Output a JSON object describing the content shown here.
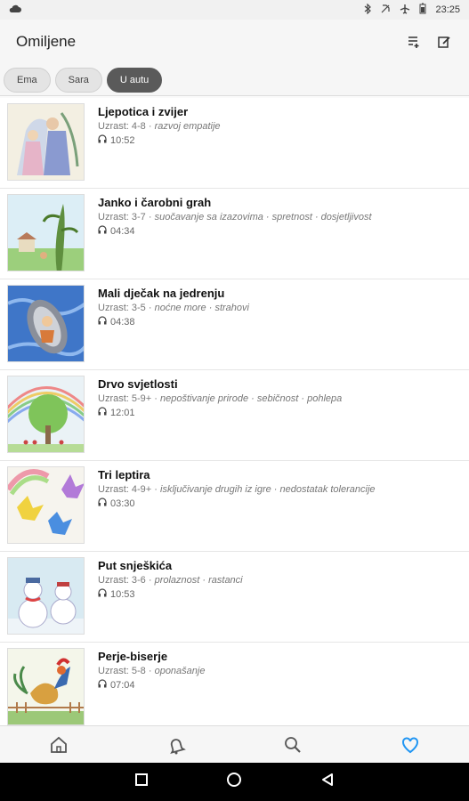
{
  "status": {
    "time": "23:25",
    "icons": [
      "cloud-icon",
      "bluetooth-icon",
      "dnd-icon",
      "airplane-icon",
      "battery-icon"
    ]
  },
  "app_bar": {
    "title": "Omiljene",
    "actions": [
      "playlist-add-icon",
      "edit-icon"
    ]
  },
  "chips": [
    {
      "label": "Ema",
      "active": false
    },
    {
      "label": "Sara",
      "active": false
    },
    {
      "label": "U autu",
      "active": true
    }
  ],
  "stories": [
    {
      "title": "Ljepotica i zvijer",
      "age": "Uzrast: 4-8",
      "topics": "razvoj empatije",
      "duration": "10:52"
    },
    {
      "title": "Janko i čarobni grah",
      "age": "Uzrast: 3-7",
      "topics": "suočavanje sa izazovima · spretnost · dosjetljivost",
      "duration": "04:34"
    },
    {
      "title": "Mali dječak na jedrenju",
      "age": "Uzrast: 3-5",
      "topics": "noćne more · strahovi",
      "duration": "04:38"
    },
    {
      "title": "Drvo svjetlosti",
      "age": "Uzrast: 5-9+",
      "topics": "nepoštivanje prirode · sebičnost · pohlepa",
      "duration": "12:01"
    },
    {
      "title": "Tri leptira",
      "age": "Uzrast: 4-9+",
      "topics": "isključivanje drugih iz igre · nedostatak tolerancije",
      "duration": "03:30"
    },
    {
      "title": "Put snješkića",
      "age": "Uzrast: 3-6",
      "topics": "prolaznost · rastanci",
      "duration": "10:53"
    },
    {
      "title": "Perje-biserje",
      "age": "Uzrast: 5-8",
      "topics": "oponašanje",
      "duration": "07:04"
    }
  ],
  "bottom_nav": [
    "home-icon",
    "bell-icon",
    "search-icon",
    "favorites-heart-icon"
  ],
  "colors": {
    "accent": "#2196f3",
    "chip_active": "#5a5a5a"
  }
}
